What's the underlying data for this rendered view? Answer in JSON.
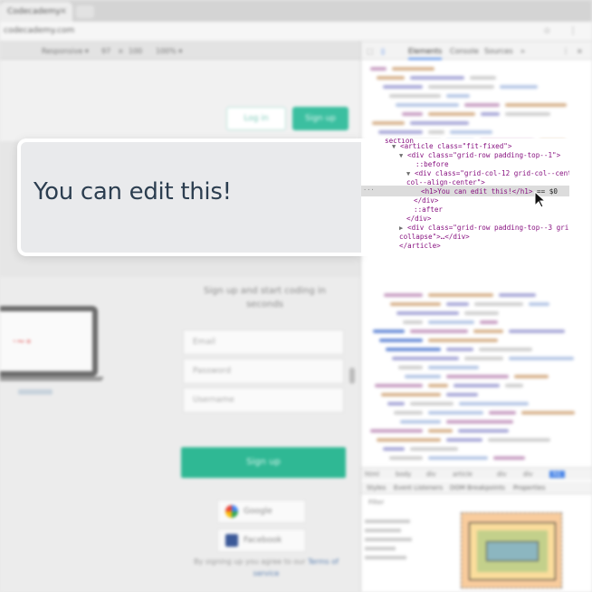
{
  "browser": {
    "tab_title": "Codecademy",
    "tab_close": "×",
    "address": "codecademy.com",
    "toolbar_icons": "☆ ⋮"
  },
  "devbar": {
    "device": "Responsive ▾",
    "width": "97",
    "times": "×",
    "height": "100",
    "zoom": "100% ▾"
  },
  "site": {
    "login_label": "Log in",
    "signup_top_label": "Sign up",
    "hero_heading": "You can edit this!",
    "tagline": "Sign up and start coding in seconds",
    "fields": {
      "email": "Email",
      "password": "Password",
      "username": "Username"
    },
    "signup_button": "Sign up",
    "google_label": "Google",
    "facebook_label": "Facebook",
    "terms_text": "By signing up you agree to our ",
    "terms_link": "Terms of service"
  },
  "devtools": {
    "tabs": [
      "Elements",
      "Console",
      "Sources"
    ],
    "more": "»",
    "crumbs": [
      "html",
      "body",
      "div",
      "article",
      "div",
      "div",
      "h1"
    ],
    "styles_tabs": [
      "Styles",
      "Event Listeners",
      "DOM Breakpoints",
      "Properties"
    ],
    "filter": "Filter"
  },
  "dom": {
    "article_open": "<article class=\"fit-fixed\">",
    "div1_open": "<div class=\"grid-row padding-top--1\">",
    "before": "::before",
    "div2_open_a": "<div class=\"grid-col-12 grid-col--cent",
    "div2_open_b": "col--align-center\">",
    "h1": "<h1>You can edit this!</h1>",
    "h1_suffix": "== $0",
    "div_close": "</div>",
    "after": "::after",
    "div_close2": "</div>",
    "div3_a": "<div class=\"grid-row padding-top--3 gri",
    "div3_b": "collapse\">…</div>",
    "article_close": "</article>",
    "section_fragment": "section"
  },
  "colors": {
    "accent_green": "#2fb894",
    "heading": "#2c3e50",
    "devtools_blue": "#4a86e8"
  }
}
